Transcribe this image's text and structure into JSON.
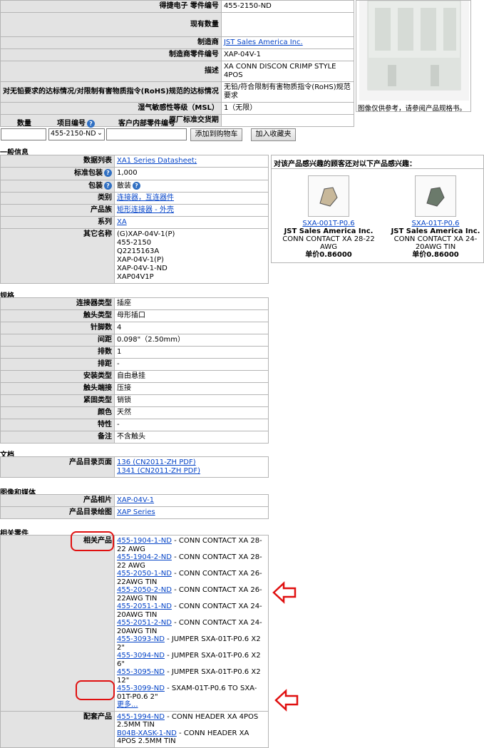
{
  "top": {
    "rows": [
      {
        "label": "得捷电子 零件编号",
        "value": "455-2150-ND"
      },
      {
        "label": "现有数量",
        "value": ""
      },
      {
        "label": "制造商",
        "value": "JST Sales America Inc.",
        "link": true
      },
      {
        "label": "制造商零件编号",
        "value": "XAP-04V-1"
      },
      {
        "label": "描述",
        "value": "XA CONN DISCON CRIMP STYLE 4POS"
      },
      {
        "label": "对无铅要求的达标情况/对限制有害物质指令(RoHS)规范的达标情况",
        "value": "无铅/符合限制有害物质指令(RoHS)规范要求"
      },
      {
        "label": "湿气敏感性等级（MSL）",
        "value": "1（无限）"
      },
      {
        "label": "原厂标准交货期",
        "value": ""
      }
    ],
    "image_caption": "图像仅供参考，请参阅产品规格书。"
  },
  "order": {
    "qty_label": "数量",
    "item_label": "项目编号",
    "customer_label": "客户内部零件编号",
    "item_select": "455-2150-ND",
    "add_cart": "添加到购物车",
    "add_fav": "加入收藏夹"
  },
  "general": {
    "title": "一般信息",
    "rows": [
      {
        "label": "数据列表",
        "lines": [
          "XA1 Series Datasheet;"
        ],
        "link": true
      },
      {
        "label": "标准包装",
        "lines": [
          "1,000"
        ],
        "help": true
      },
      {
        "label": "包装",
        "lines": [
          "散装"
        ],
        "help": true,
        "vhelp": true
      },
      {
        "label": "类别",
        "lines": [
          "连接器，互连器件"
        ],
        "link": true
      },
      {
        "label": "产品族",
        "lines": [
          "矩形连接器 - 外壳"
        ],
        "link": true
      },
      {
        "label": "系列",
        "lines": [
          "XA"
        ],
        "link": true
      },
      {
        "label": "其它名称",
        "lines": [
          "(G)XAP-04V-1(P)",
          "455-2150",
          "Q2215163A",
          "XAP-04V-1(P)",
          "XAP-04V-1-ND",
          "XAP04V1P"
        ]
      }
    ]
  },
  "interest": {
    "title": "对该产品感兴趣的顾客还对以下产品感兴趣：",
    "products": [
      {
        "pn": "SXA-001T-P0.6",
        "mfr": "JST Sales America Inc.",
        "desc": "CONN CONTACT XA 28-22 AWG",
        "price": "单价0.86000"
      },
      {
        "pn": "SXA-01T-P0.6",
        "mfr": "JST Sales America Inc.",
        "desc": "CONN CONTACT XA 24-20AWG TIN",
        "price": "单价0.86000"
      }
    ]
  },
  "specs": {
    "title": "规格",
    "rows": [
      {
        "label": "连接器类型",
        "value": "插座"
      },
      {
        "label": "触头类型",
        "value": "母形插口"
      },
      {
        "label": "针脚数",
        "value": "4"
      },
      {
        "label": "间距",
        "value": "0.098\"（2.50mm）"
      },
      {
        "label": "排数",
        "value": "1"
      },
      {
        "label": "排距",
        "value": "-"
      },
      {
        "label": "安装类型",
        "value": "自由悬挂"
      },
      {
        "label": "触头端接",
        "value": "压接"
      },
      {
        "label": "紧固类型",
        "value": "销锁"
      },
      {
        "label": "颜色",
        "value": "天然"
      },
      {
        "label": "特性",
        "value": "-"
      },
      {
        "label": "备注",
        "value": "不含触头"
      }
    ]
  },
  "docs": {
    "title": "文档",
    "label": "产品目录页面",
    "links": [
      "136 (CN2011-ZH PDF)",
      "1341 (CN2011-ZH PDF)"
    ]
  },
  "media": {
    "title": "图像和媒体",
    "rows": [
      {
        "label": "产品相片",
        "value": "XAP-04V-1"
      },
      {
        "label": "产品目录绘图",
        "value": "XAP Series"
      }
    ]
  },
  "related": {
    "title": "相关零件",
    "related_label": "相关产品",
    "related_items": [
      {
        "pn": "455-1904-1-ND",
        "desc": " - CONN CONTACT XA 28-22 AWG"
      },
      {
        "pn": "455-1904-2-ND",
        "desc": " - CONN CONTACT XA 28-22 AWG"
      },
      {
        "pn": "455-2050-1-ND",
        "desc": " - CONN CONTACT XA 26-22AWG TIN"
      },
      {
        "pn": "455-2050-2-ND",
        "desc": " - CONN CONTACT XA 26-22AWG TIN"
      },
      {
        "pn": "455-2051-1-ND",
        "desc": " - CONN CONTACT XA 24-20AWG TIN"
      },
      {
        "pn": "455-2051-2-ND",
        "desc": " - CONN CONTACT XA 24-20AWG TIN"
      },
      {
        "pn": "455-3093-ND",
        "desc": " - JUMPER SXA-01T-P0.6 X2 2\""
      },
      {
        "pn": "455-3094-ND",
        "desc": " - JUMPER SXA-01T-P0.6 X2 6\""
      },
      {
        "pn": "455-3095-ND",
        "desc": " - JUMPER SXA-01T-P0.6 X2 12\""
      },
      {
        "pn": "455-3099-ND",
        "desc": " - SXAM-01T-P0.6 TO SXA-01T-P0.6 2\""
      }
    ],
    "more": "更多...",
    "mating_label": "配套产品",
    "mating_items": [
      {
        "pn": "455-1994-ND",
        "desc": " - CONN HEADER XA 4POS 2.5MM TIN"
      },
      {
        "pn": "B04B-XASK-1-ND",
        "desc": " - CONN HEADER XA 4POS 2.5MM TIN"
      }
    ]
  },
  "colors": {
    "label_bg": "#e3e3e3",
    "border": "#b5b5b5",
    "link": "#0645c8",
    "annotation": "#e01010"
  }
}
